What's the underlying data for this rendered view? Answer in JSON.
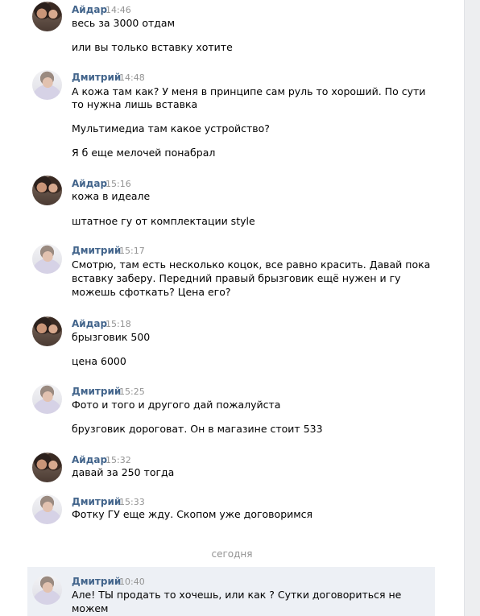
{
  "messages": [
    {
      "author": "Айдар",
      "time": "14:46",
      "lines": [
        "весь за 3000 отдам",
        "или вы только вставку хотите"
      ]
    },
    {
      "author": "Дмитрий",
      "time": "14:48",
      "lines": [
        "А кожа там как? У меня в принципе сам руль то хороший. По сути",
        "то нужна лишь вставка",
        "Мультимедиа там какое устройство?",
        "Я б еще мелочей понабрал"
      ]
    },
    {
      "author": "Айдар",
      "time": "15:16",
      "lines": [
        "кожа в идеале",
        "штатное гу от комплектации style"
      ]
    },
    {
      "author": "Дмитрий",
      "time": "15:17",
      "lines": [
        "Смотрю, там есть несколько коцок, все равно красить. Давай пока",
        "вставку заберу. Передний правый брызговик ещё нужен и гу",
        "можешь сфоткать? Цена его?"
      ]
    },
    {
      "author": "Айдар",
      "time": "15:18",
      "lines": [
        "брызговик 500",
        "цена 6000"
      ]
    },
    {
      "author": "Дмитрий",
      "time": "15:25",
      "lines": [
        "Фото и того и другого дай пожалуйста",
        "брузговик дороговат. Он в магазине стоит 533"
      ]
    },
    {
      "author": "Айдар",
      "time": "15:32",
      "lines": [
        "давай за 250 тогда"
      ]
    },
    {
      "author": "Дмитрий",
      "time": "15:33",
      "lines": [
        "Фотку ГУ еще жду. Скопом уже договоримся"
      ]
    },
    {
      "author": "Дмитрий",
      "time": "10:40",
      "lines": [
        "Але! ТЫ продать то хочешь, или как ? Сутки договориться не",
        "можем"
      ]
    }
  ],
  "separator": "сегодня"
}
